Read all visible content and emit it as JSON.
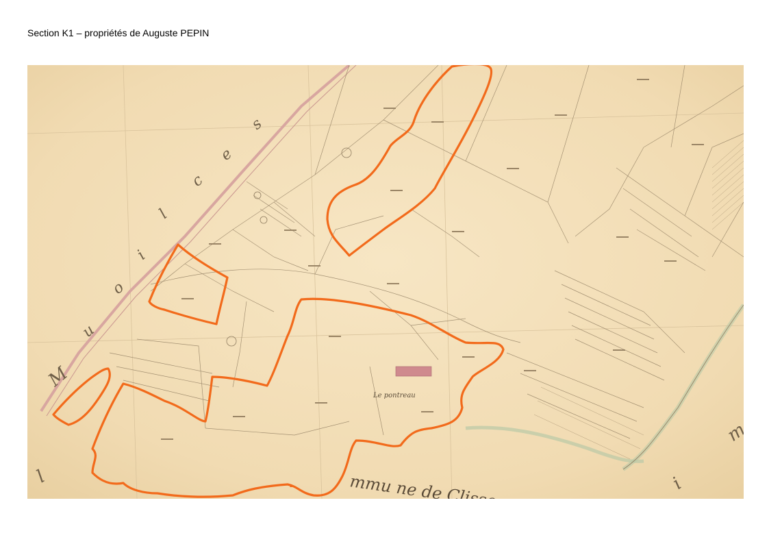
{
  "page": {
    "title": "Section K1 – propriétés de Auguste PEPIN"
  },
  "map": {
    "place_labels": {
      "le_pontreau": "Le pontreau",
      "commune_de_clisson": "mmu ne de Clisson"
    },
    "colors": {
      "paper": "#f3dfb9",
      "ink": "#8f7c60",
      "road": "#d8a6a0",
      "house": "#cf8a8e",
      "property_outline": "#f26a1b",
      "water": "#b9c9a7"
    }
  }
}
